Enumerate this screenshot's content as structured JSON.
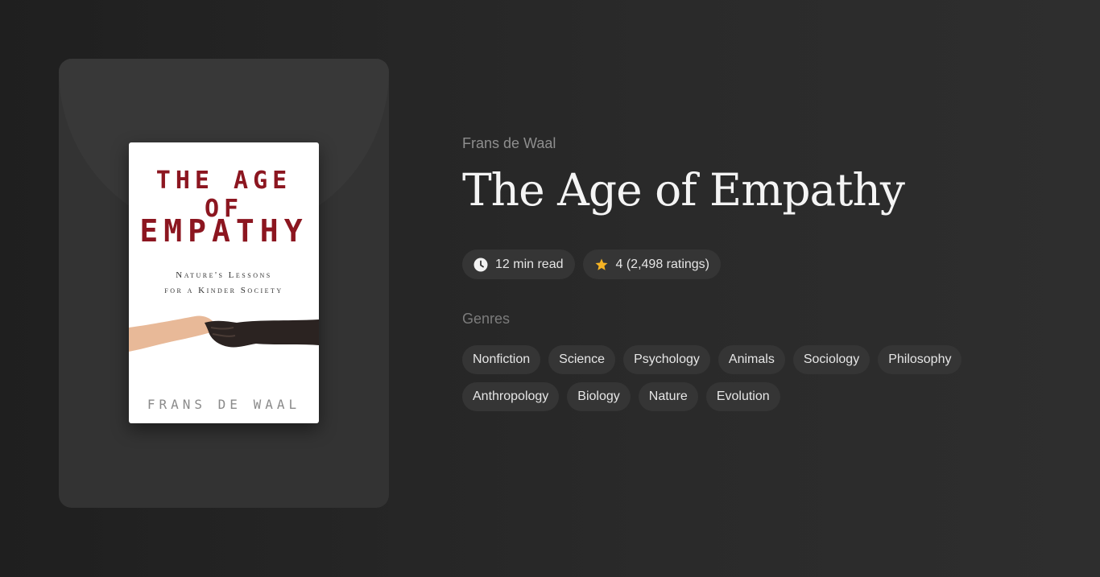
{
  "book": {
    "cover": {
      "title_line1": "THE AGE OF",
      "title_line2": "EMPATHY",
      "subtitle_line1": "Nature's Lessons",
      "subtitle_line2": "for a Kinder Society",
      "author": "FRANS DE WAAL",
      "title_color": "#8c1620"
    },
    "author": "Frans de Waal",
    "title": "The Age of Empathy",
    "meta": {
      "read_time": "12 min read",
      "read_time_icon": "clock-icon",
      "rating": "4 (2,498 ratings)",
      "rating_icon": "star-icon",
      "star_color": "#f5b324"
    },
    "genres_label": "Genres",
    "genres": [
      "Nonfiction",
      "Science",
      "Psychology",
      "Animals",
      "Sociology",
      "Philosophy",
      "Anthropology",
      "Biology",
      "Nature",
      "Evolution"
    ]
  }
}
